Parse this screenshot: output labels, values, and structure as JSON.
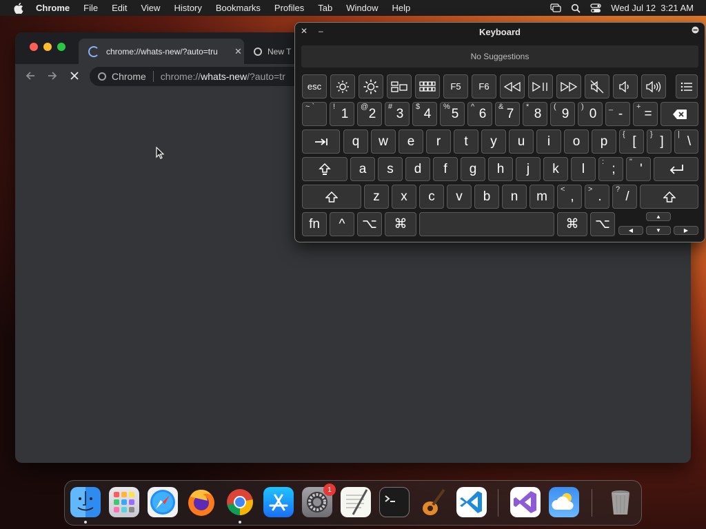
{
  "menubar": {
    "app_name": "Chrome",
    "items": [
      "File",
      "Edit",
      "View",
      "History",
      "Bookmarks",
      "Profiles",
      "Tab",
      "Window",
      "Help"
    ],
    "clock": "Wed Jul 12  3:21 AM"
  },
  "browser": {
    "tabs": [
      {
        "title": "chrome://whats-new/?auto=tru",
        "state": "loading"
      },
      {
        "title": "New T"
      }
    ],
    "omnibox": {
      "chip": "Chrome",
      "url_prefix": "chrome://",
      "url_host": "whats-new",
      "url_rest": "/?auto=tr"
    }
  },
  "keyboard_viewer": {
    "title": "Keyboard",
    "suggestions": "No Suggestions",
    "rows": {
      "function": [
        "esc",
        "brightness-down-icon",
        "brightness-up-icon",
        "mission-control-icon",
        "launchpad-icon",
        "F5",
        "F6",
        "rewind-icon",
        "play-pause-icon",
        "fast-forward-icon",
        "mute-icon",
        "volume-down-icon",
        "volume-up-icon",
        "menu-icon"
      ],
      "number": [
        {
          "shift": "~ `",
          "main": ""
        },
        {
          "shift": "!",
          "main": "1"
        },
        {
          "shift": "@",
          "main": "2"
        },
        {
          "shift": "#",
          "main": "3"
        },
        {
          "shift": "$",
          "main": "4"
        },
        {
          "shift": "%",
          "main": "5"
        },
        {
          "shift": "^",
          "main": "6"
        },
        {
          "shift": "&",
          "main": "7"
        },
        {
          "shift": "*",
          "main": "8"
        },
        {
          "shift": "(",
          "main": "9"
        },
        {
          "shift": ")",
          "main": "0"
        },
        {
          "shift": "_",
          "main": "-"
        },
        {
          "shift": "+",
          "main": "="
        }
      ],
      "top_letters": [
        "q",
        "w",
        "e",
        "r",
        "t",
        "y",
        "u",
        "i",
        "o",
        "p"
      ],
      "top_symbols": [
        {
          "shift": "{",
          "main": "["
        },
        {
          "shift": "}",
          "main": "]"
        },
        {
          "shift": "|",
          "main": "\\"
        }
      ],
      "home_letters": [
        "a",
        "s",
        "d",
        "f",
        "g",
        "h",
        "j",
        "k",
        "l"
      ],
      "home_symbols": [
        {
          "shift": ":",
          "main": ";"
        },
        {
          "shift": "\"",
          "main": "'"
        }
      ],
      "bottom_letters": [
        "z",
        "x",
        "c",
        "v",
        "b",
        "n",
        "m"
      ],
      "bottom_symbols": [
        {
          "shift": "<",
          "main": ","
        },
        {
          "shift": ">",
          "main": "."
        },
        {
          "shift": "?",
          "main": "/"
        }
      ],
      "modifiers": {
        "fn": "fn",
        "control": "^",
        "option": "⌥",
        "command": "⌘"
      },
      "arrows": {
        "up": "▲",
        "left": "◀",
        "down": "▼",
        "right": "▶"
      }
    }
  },
  "dock": {
    "apps": [
      "Finder",
      "Launchpad",
      "Safari",
      "Firefox",
      "Google Chrome",
      "App Store",
      "System Settings",
      "TextEdit",
      "Terminal",
      "GarageBand",
      "Visual Studio Code",
      "Visual Studio",
      "Weather",
      "Trash"
    ],
    "settings_badge": "1"
  }
}
